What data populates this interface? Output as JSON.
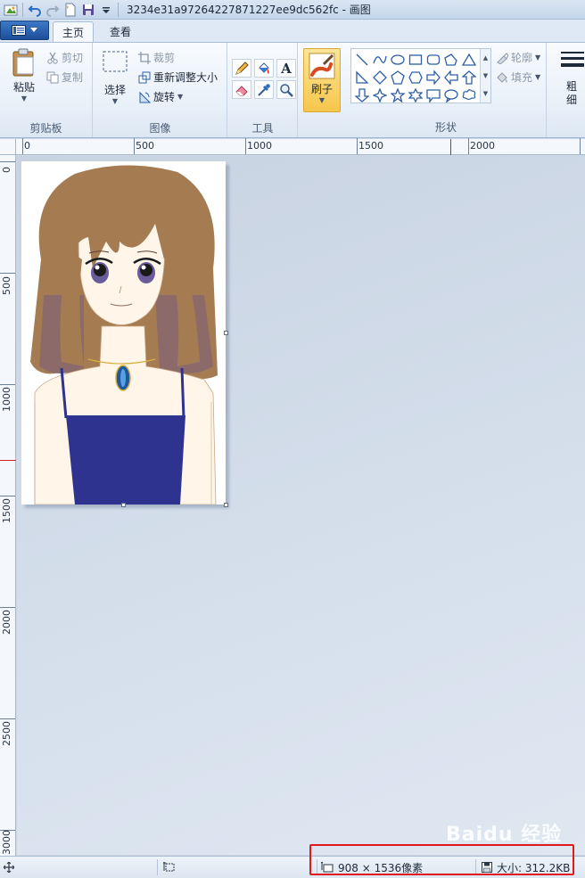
{
  "window": {
    "title": "3234e31a97264227871227ee9dc562fc - 画图"
  },
  "tabs": {
    "home": "主页",
    "view": "查看"
  },
  "ribbon": {
    "clipboard": {
      "label": "剪贴板",
      "paste": "粘贴",
      "cut": "剪切",
      "copy": "复制"
    },
    "image": {
      "label": "图像",
      "select": "选择",
      "crop": "裁剪",
      "resize": "重新调整大小",
      "rotate": "旋转"
    },
    "tools": {
      "label": "工具",
      "items": [
        "pencil-icon",
        "fill-icon",
        "text-icon",
        "eraser-icon",
        "color-picker-icon",
        "magnifier-icon"
      ]
    },
    "brushes": {
      "label": "刷子"
    },
    "shapes": {
      "label": "形状",
      "outline": "轮廓",
      "fill": "填充"
    },
    "size": {
      "label": "粗细"
    }
  },
  "ruler": {
    "horizontal": [
      "0",
      "500",
      "1000",
      "1500",
      "2000"
    ],
    "vertical": [
      "0",
      "500",
      "1000",
      "1500",
      "2000",
      "2500",
      "3000"
    ]
  },
  "status": {
    "dimensions": "908 × 1536像素",
    "size": "大小: 312.2KB"
  },
  "watermark": {
    "text": "Baidu 经验"
  },
  "colors": {
    "accent": "#1c4f9c",
    "highlight": "#e0191a",
    "hair": "#a57c52",
    "dress": "#2e338f"
  }
}
